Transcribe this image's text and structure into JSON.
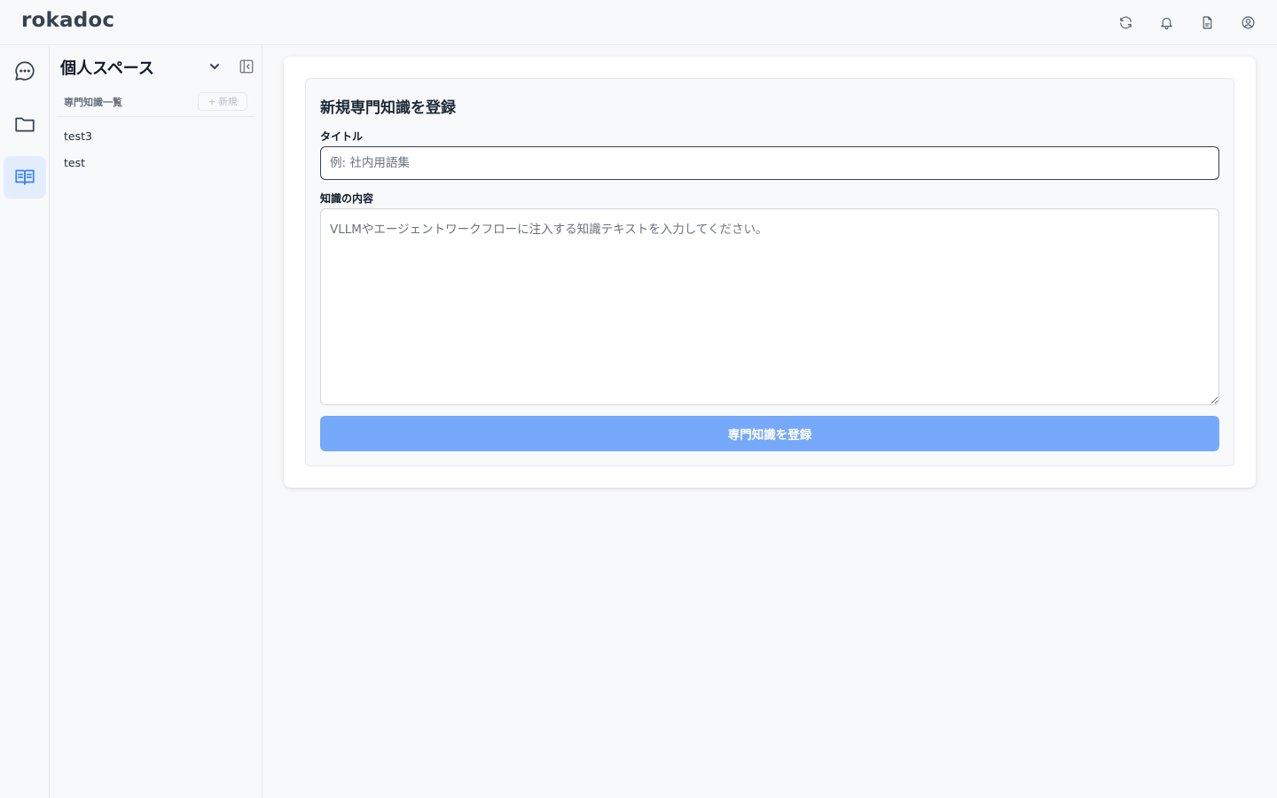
{
  "app": {
    "brand": "rokadoc"
  },
  "topbar": {
    "icons": [
      "refresh-icon",
      "bell-icon",
      "document-icon",
      "user-circle-icon"
    ]
  },
  "rail": {
    "items": [
      {
        "icon": "chat-bubble-icon",
        "active": false
      },
      {
        "icon": "folder-icon",
        "active": false
      },
      {
        "icon": "book-open-icon",
        "active": true
      }
    ]
  },
  "sidebar": {
    "space_title": "個人スペース",
    "list_header": "専門知識一覧",
    "new_button": "新規",
    "items": [
      {
        "label": "test3"
      },
      {
        "label": "test"
      }
    ]
  },
  "form": {
    "title": "新規専門知識を登録",
    "title_label": "タイトル",
    "title_placeholder": "例: 社内用語集",
    "title_value": "",
    "content_label": "知識の内容",
    "content_placeholder": "VLLMやエージェントワークフローに注入する知識テキストを入力してください。",
    "content_value": "",
    "submit_label": "専門知識を登録"
  },
  "colors": {
    "accent": "#3b82f6",
    "accent_light": "#e3edfd",
    "submit_disabled": "#76a9f9"
  }
}
